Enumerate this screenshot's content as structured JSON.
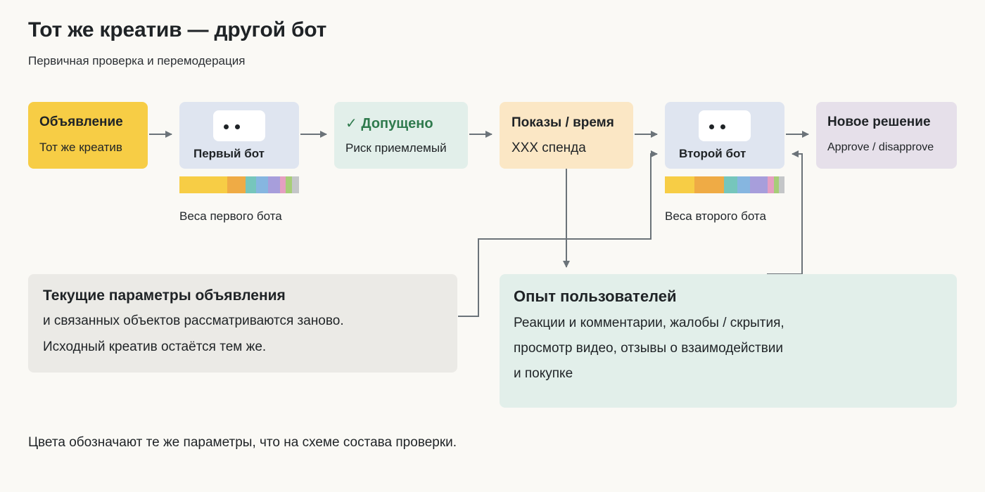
{
  "header": {
    "title": "Тот же креатив — другой бот",
    "subtitle": "Первичная проверка и перемодерация"
  },
  "flow": {
    "ad": {
      "title": "Объявление",
      "text": "Тот же креатив"
    },
    "bot1": {
      "title": "Первый бот",
      "weights_caption": "Веса первого бота"
    },
    "approved": {
      "check": "✓",
      "title": "Допущено",
      "text": "Риск приемлемый"
    },
    "shows": {
      "title": "Показы / время",
      "text": "XXX спенда"
    },
    "bot2": {
      "title": "Второй бот",
      "weights_caption": "Веса второго бота"
    },
    "new_decision": {
      "title": "Новое решение",
      "text": "Approve / disapprove"
    }
  },
  "weights": {
    "bot1": [
      {
        "color": "#f7cd45",
        "share": 0.4
      },
      {
        "color": "#efab45",
        "share": 0.15
      },
      {
        "color": "#76c6bc",
        "share": 0.09
      },
      {
        "color": "#86b6e0",
        "share": 0.1
      },
      {
        "color": "#a79edb",
        "share": 0.1
      },
      {
        "color": "#e59fc1",
        "share": 0.05
      },
      {
        "color": "#a7cd78",
        "share": 0.05
      },
      {
        "color": "#c4c6c8",
        "share": 0.06
      }
    ],
    "bot2": [
      {
        "color": "#f7cd45",
        "share": 0.25
      },
      {
        "color": "#efab45",
        "share": 0.25
      },
      {
        "color": "#76c6bc",
        "share": 0.11
      },
      {
        "color": "#86b6e0",
        "share": 0.11
      },
      {
        "color": "#a79edb",
        "share": 0.15
      },
      {
        "color": "#e59fc1",
        "share": 0.05
      },
      {
        "color": "#a7cd78",
        "share": 0.04
      },
      {
        "color": "#c4c6c8",
        "share": 0.05
      }
    ]
  },
  "params": {
    "title": "Текущие параметры объявления",
    "line1": "и связанных объектов рассматриваются заново.",
    "line2": "Исходный креатив остаётся тем же."
  },
  "experience": {
    "title": "Опыт пользователей",
    "line1": "Реакции и комментарии, жалобы / скрытия,",
    "line2": "просмотр видео, отзывы о взаимодействии",
    "line3": "и покупке"
  },
  "footer": "Цвета обозначают те же параметры, что на схеме состава проверки.",
  "colors": {
    "background": "#faf9f5",
    "ad": "#f7cd45",
    "bot": "#dfe5f0",
    "approved": "#e2efea",
    "approved_text": "#2f7a4d",
    "shows": "#fbe7c5",
    "new_decision": "#e6e0ea",
    "params": "#ebeae6",
    "experience": "#e2efea",
    "arrow": "#6b7379"
  }
}
